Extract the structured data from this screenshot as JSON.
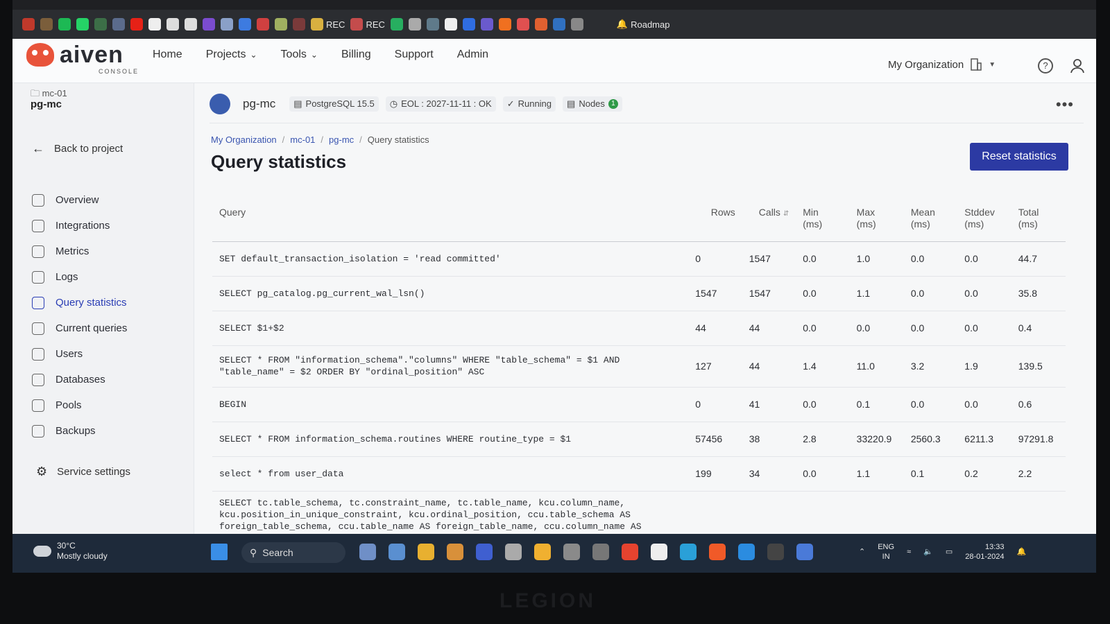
{
  "browser": {
    "bookmarks": [
      {
        "icon": "site-icon-1",
        "color": "#c0392b"
      },
      {
        "icon": "site-icon-2",
        "color": "#7b5e3b"
      },
      {
        "icon": "spotify-icon",
        "color": "#1db954"
      },
      {
        "icon": "whatsapp-icon",
        "color": "#25d366"
      },
      {
        "icon": "site-icon-5",
        "color": "#3c6e47"
      },
      {
        "icon": "site-icon-6",
        "color": "#5b6b8c"
      },
      {
        "icon": "youtube-icon",
        "color": "#e62117"
      },
      {
        "icon": "github-icon",
        "color": "#eeeeee"
      },
      {
        "icon": "google-icon",
        "color": "#dddddd"
      },
      {
        "icon": "google-icon",
        "color": "#dddddd"
      },
      {
        "icon": "site-icon-11",
        "color": "#7b4ccf"
      },
      {
        "icon": "site-icon-12",
        "color": "#8aa0c8"
      },
      {
        "icon": "site-icon-13",
        "color": "#3d7be0"
      },
      {
        "icon": "site-icon-14",
        "color": "#d04040"
      },
      {
        "icon": "site-icon-15",
        "color": "#a0b060"
      },
      {
        "icon": "site-icon-16",
        "color": "#7a3a3a"
      }
    ],
    "labeled_bookmarks": [
      {
        "label": "REC",
        "color": "#d8b040"
      },
      {
        "label": "REC",
        "color": "#c44c4c"
      }
    ],
    "bookmarks2": [
      {
        "icon": "site-icon-17",
        "color": "#27ae60"
      },
      {
        "icon": "site-icon-18",
        "color": "#aaaaaa"
      },
      {
        "icon": "site-icon-19",
        "color": "#5f7a8a"
      },
      {
        "icon": "amazon-icon",
        "color": "#eeeeee"
      },
      {
        "icon": "site-icon-21",
        "color": "#2f6de1"
      },
      {
        "icon": "site-icon-22",
        "color": "#6a5acd"
      },
      {
        "icon": "site-icon-23",
        "color": "#f07020"
      },
      {
        "icon": "site-icon-24",
        "color": "#e05050"
      },
      {
        "icon": "site-icon-25",
        "color": "#e06030"
      },
      {
        "icon": "site-icon-26",
        "color": "#3070c0"
      },
      {
        "icon": "site-icon-27",
        "color": "#888888"
      }
    ],
    "roadmap_label": "Roadmap"
  },
  "header": {
    "logo_text": "aiven",
    "logo_sub": "CONSOLE",
    "nav": [
      "Home",
      "Projects",
      "Tools",
      "Billing",
      "Support",
      "Admin"
    ],
    "nav_dropdowns": [
      false,
      true,
      true,
      false,
      false,
      false
    ],
    "org_label": "My Organization",
    "help_glyph": "?"
  },
  "sidebar": {
    "project": "mc-01",
    "service": "pg-mc",
    "back_label": "Back to project",
    "items": [
      {
        "label": "Overview",
        "icon": "overview-icon"
      },
      {
        "label": "Integrations",
        "icon": "integrations-icon"
      },
      {
        "label": "Metrics",
        "icon": "metrics-icon"
      },
      {
        "label": "Logs",
        "icon": "logs-icon"
      },
      {
        "label": "Query statistics",
        "icon": "query-statistics-icon",
        "active": true
      },
      {
        "label": "Current queries",
        "icon": "current-queries-icon"
      },
      {
        "label": "Users",
        "icon": "users-icon"
      },
      {
        "label": "Databases",
        "icon": "databases-icon"
      },
      {
        "label": "Pools",
        "icon": "pools-icon"
      },
      {
        "label": "Backups",
        "icon": "backups-icon"
      }
    ],
    "settings_label": "Service settings"
  },
  "service": {
    "name": "pg-mc",
    "version": "PostgreSQL 15.5",
    "eol": "EOL : 2027-11-11 : OK",
    "status": "Running",
    "nodes_label": "Nodes",
    "nodes_count": "1"
  },
  "page": {
    "breadcrumbs": [
      "My Organization",
      "mc-01",
      "pg-mc",
      "Query statistics"
    ],
    "title": "Query statistics",
    "reset_label": "Reset statistics"
  },
  "table": {
    "headers": {
      "query": "Query",
      "rows": "Rows",
      "calls": "Calls",
      "min": "Min",
      "max": "Max",
      "mean": "Mean",
      "stddev": "Stddev",
      "total": "Total",
      "unit": "(ms)"
    },
    "rows": [
      {
        "query": "SET default_transaction_isolation = 'read committed'",
        "rows": "0",
        "calls": "1547",
        "min": "0.0",
        "max": "1.0",
        "mean": "0.0",
        "stddev": "0.0",
        "total": "44.7"
      },
      {
        "query": "SELECT pg_catalog.pg_current_wal_lsn()",
        "rows": "1547",
        "calls": "1547",
        "min": "0.0",
        "max": "1.1",
        "mean": "0.0",
        "stddev": "0.0",
        "total": "35.8"
      },
      {
        "query": "SELECT $1+$2",
        "rows": "44",
        "calls": "44",
        "min": "0.0",
        "max": "0.0",
        "mean": "0.0",
        "stddev": "0.0",
        "total": "0.4"
      },
      {
        "query": "SELECT * FROM \"information_schema\".\"columns\" WHERE \"table_schema\" = $1 AND \"table_name\" = $2 ORDER BY \"ordinal_position\" ASC",
        "rows": "127",
        "calls": "44",
        "min": "1.4",
        "max": "11.0",
        "mean": "3.2",
        "stddev": "1.9",
        "total": "139.5"
      },
      {
        "query": "BEGIN",
        "rows": "0",
        "calls": "41",
        "min": "0.0",
        "max": "0.1",
        "mean": "0.0",
        "stddev": "0.0",
        "total": "0.6"
      },
      {
        "query": "SELECT * FROM information_schema.routines WHERE routine_type = $1",
        "rows": "57456",
        "calls": "38",
        "min": "2.8",
        "max": "33220.9",
        "mean": "2560.3",
        "stddev": "6211.3",
        "total": "97291.8"
      },
      {
        "query": "select * from user_data",
        "rows": "199",
        "calls": "34",
        "min": "0.0",
        "max": "1.1",
        "mean": "0.1",
        "stddev": "0.2",
        "total": "2.2"
      },
      {
        "query": "SELECT tc.table_schema, tc.constraint_name, tc.table_name, kcu.column_name, kcu.position_in_unique_constraint, kcu.ordinal_position, ccu.table_schema AS foreign_table_schema, ccu.table_name AS foreign_table_name, ccu.column_name AS foreign_column_name, rc.update_rule, rc.delete_rule FROM",
        "rows": "",
        "calls": "",
        "min": "",
        "max": "",
        "mean": "",
        "stddev": "",
        "total": ""
      }
    ]
  },
  "taskbar": {
    "temperature": "30°C",
    "weather": "Mostly cloudy",
    "search_label": "Search",
    "apps": [
      {
        "icon": "photos-icon",
        "color": "#6f8fc7"
      },
      {
        "icon": "store-icon",
        "color": "#5a8fd0"
      },
      {
        "icon": "file-explorer-icon",
        "color": "#e8b030"
      },
      {
        "icon": "app-icon-r",
        "color": "#d8903a"
      },
      {
        "icon": "app-icon-l",
        "color": "#3f5fd0"
      },
      {
        "icon": "app-icon-gray",
        "color": "#aaaaaa"
      },
      {
        "icon": "folder-icon",
        "color": "#f0b030"
      },
      {
        "icon": "settings-icon",
        "color": "#8a8a8a"
      },
      {
        "icon": "clock-app-icon",
        "color": "#777777"
      },
      {
        "icon": "chrome-icon",
        "color": "#e5432f"
      },
      {
        "icon": "notion-icon",
        "color": "#eeeeee"
      },
      {
        "icon": "edge-icon",
        "color": "#2aa0d8"
      },
      {
        "icon": "brave-icon",
        "color": "#f05a28"
      },
      {
        "icon": "vscode-icon",
        "color": "#2b8ce0"
      },
      {
        "icon": "terminal-icon",
        "color": "#444444"
      },
      {
        "icon": "app-icon-blue",
        "color": "#4a7ad8"
      }
    ],
    "lang": "ENG",
    "region": "IN",
    "time": "13:33",
    "date": "28-01-2024"
  },
  "bezel_brand": "LEGION"
}
